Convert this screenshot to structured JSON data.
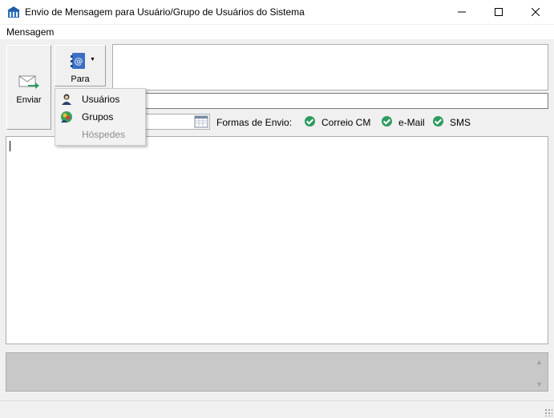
{
  "window": {
    "title": "Envio de Mensagem para Usuário/Grupo de Usuários do Sistema"
  },
  "menu": {
    "items": [
      {
        "label": "Mensagem"
      }
    ]
  },
  "toolbar": {
    "send_label": "Enviar",
    "to_label": "Para"
  },
  "dropdown": {
    "items": [
      {
        "label": "Usuários",
        "enabled": true,
        "icon": "user-icon"
      },
      {
        "label": "Grupos",
        "enabled": true,
        "icon": "group-icon"
      },
      {
        "label": "Hóspedes",
        "enabled": false,
        "icon": ""
      }
    ]
  },
  "fields": {
    "recipients_value": "",
    "subject_value": "",
    "date_value": "",
    "body_value": ""
  },
  "send_methods": {
    "label": "Formas de Envio:",
    "options": [
      {
        "label": "Correio CM",
        "checked": true
      },
      {
        "label": "e-Mail",
        "checked": true
      },
      {
        "label": "SMS",
        "checked": true
      }
    ]
  },
  "colors": {
    "check_green": "#2e9b5f",
    "status_gray": "#c8c8c8"
  }
}
